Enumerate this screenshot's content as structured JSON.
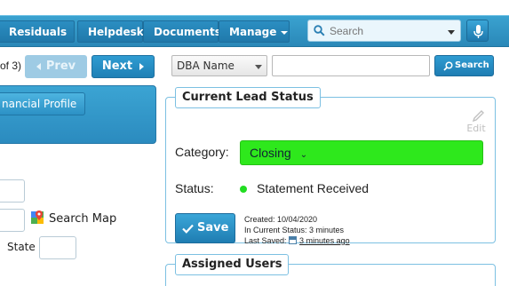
{
  "nav": {
    "items": [
      {
        "label": "Residuals",
        "has_caret": true
      },
      {
        "label": "Helpdesk",
        "has_caret": false
      },
      {
        "label": "Documents",
        "has_caret": false
      },
      {
        "label": "Manage",
        "has_caret": true
      }
    ],
    "search_placeholder": "Search"
  },
  "pagination": {
    "info": "of 3)",
    "prev_label": "Prev",
    "next_label": "Next"
  },
  "search_bar": {
    "field_select": "DBA Name",
    "query_value": "",
    "button_label": "Search"
  },
  "left_panel": {
    "tab_label": "nancial Profile",
    "search_map_label": "Search Map",
    "state_label": "State"
  },
  "lead_status": {
    "legend": "Current Lead Status",
    "edit_label": "Edit",
    "category_label": "Category:",
    "category_value": "Closing",
    "status_label": "Status:",
    "status_value": "Statement Received",
    "status_color": "#22dd22",
    "save_label": "Save",
    "created": "Created: 10/04/2020",
    "in_current_status": "In Current Status: 3 minutes",
    "last_saved_label": "Last Saved:",
    "last_saved_value": "3 minutes ago"
  },
  "assigned_users": {
    "legend": "Assigned Users"
  },
  "colors": {
    "accent": "#2a8fc2",
    "category_bg": "#2ee81c"
  }
}
